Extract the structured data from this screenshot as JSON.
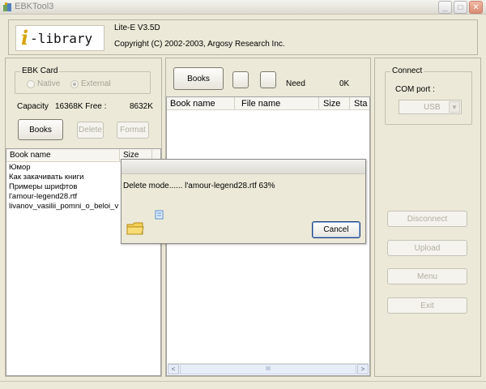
{
  "window": {
    "title": "EBKTool3",
    "minimize_glyph": "_",
    "maximize_glyph": "□",
    "close_glyph": "✕"
  },
  "header": {
    "logo_i": "i",
    "logo_text": "-library",
    "version": "Lite-E V3.5D",
    "copyright": "Copyright (C) 2002-2003, Argosy Research Inc."
  },
  "ebk": {
    "group_title": "EBK Card",
    "native_label": "Native",
    "external_label": "External",
    "capacity_label": "Capacity",
    "capacity_value": "16368K Free :",
    "free_value": "8632K",
    "books_button": "Books",
    "delete_button": "Delete",
    "format_button": "Format",
    "list_headers": [
      "Book name",
      "Size"
    ],
    "list_items": [
      "Юмор",
      "Как закачивать книги",
      "Примеры шрифтов",
      " l'amour-legend28.rtf",
      " livanov_vasilii_pomni_o_beloi_v"
    ]
  },
  "middle": {
    "books_button": "Books",
    "need_label": "Need",
    "need_value": "0K",
    "list_headers": [
      "Book name",
      "File name",
      "Size",
      "Sta"
    ],
    "scroll_left": "<",
    "scroll_right": ">",
    "scroll_thumb": "III"
  },
  "connect": {
    "group_title": "Connect",
    "com_port_label": "COM port :",
    "com_port_value": "USB",
    "disconnect_button": "Disconnect",
    "upload_button": "Upload",
    "menu_button": "Menu",
    "exit_button": "Exit"
  },
  "dialog": {
    "message": "Delete mode......  l'amour-legend28.rtf 63%",
    "progress_percent": 63,
    "cancel_button": "Cancel"
  },
  "icons": {
    "app": "books-app-icon",
    "folder": "folder-icon",
    "paper": "flying-paper-icon"
  }
}
